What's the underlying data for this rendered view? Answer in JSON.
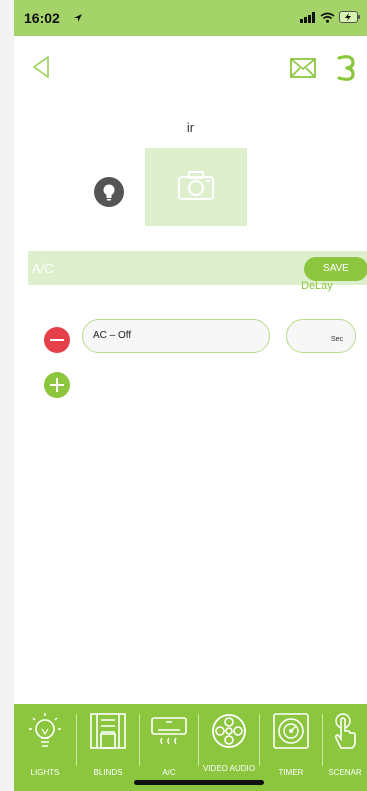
{
  "status": {
    "time": "16:02"
  },
  "device": {
    "name": "ir"
  },
  "title_bar": {
    "label": "A/C",
    "save_label": "SAVE"
  },
  "delay": {
    "label": "DeLay",
    "unit": "Sec"
  },
  "actions": [
    {
      "text": "AC – Off"
    }
  ],
  "tabs": [
    {
      "label": "LIGHTS",
      "icon": "lightbulb-icon"
    },
    {
      "label": "BLINDS",
      "icon": "blinds-icon"
    },
    {
      "label": "A/C",
      "icon": "air-conditioner-icon"
    },
    {
      "label": "VIDEO AUDIO",
      "icon": "film-reel-icon"
    },
    {
      "label": "TIMER",
      "icon": "timer-icon"
    },
    {
      "label": "SCENAR",
      "icon": "hand-touch-icon"
    }
  ],
  "colors": {
    "accent": "#8cc63f",
    "status_bar": "#a4d36a",
    "panel": "#deefcd",
    "remove": "#e5404a"
  }
}
